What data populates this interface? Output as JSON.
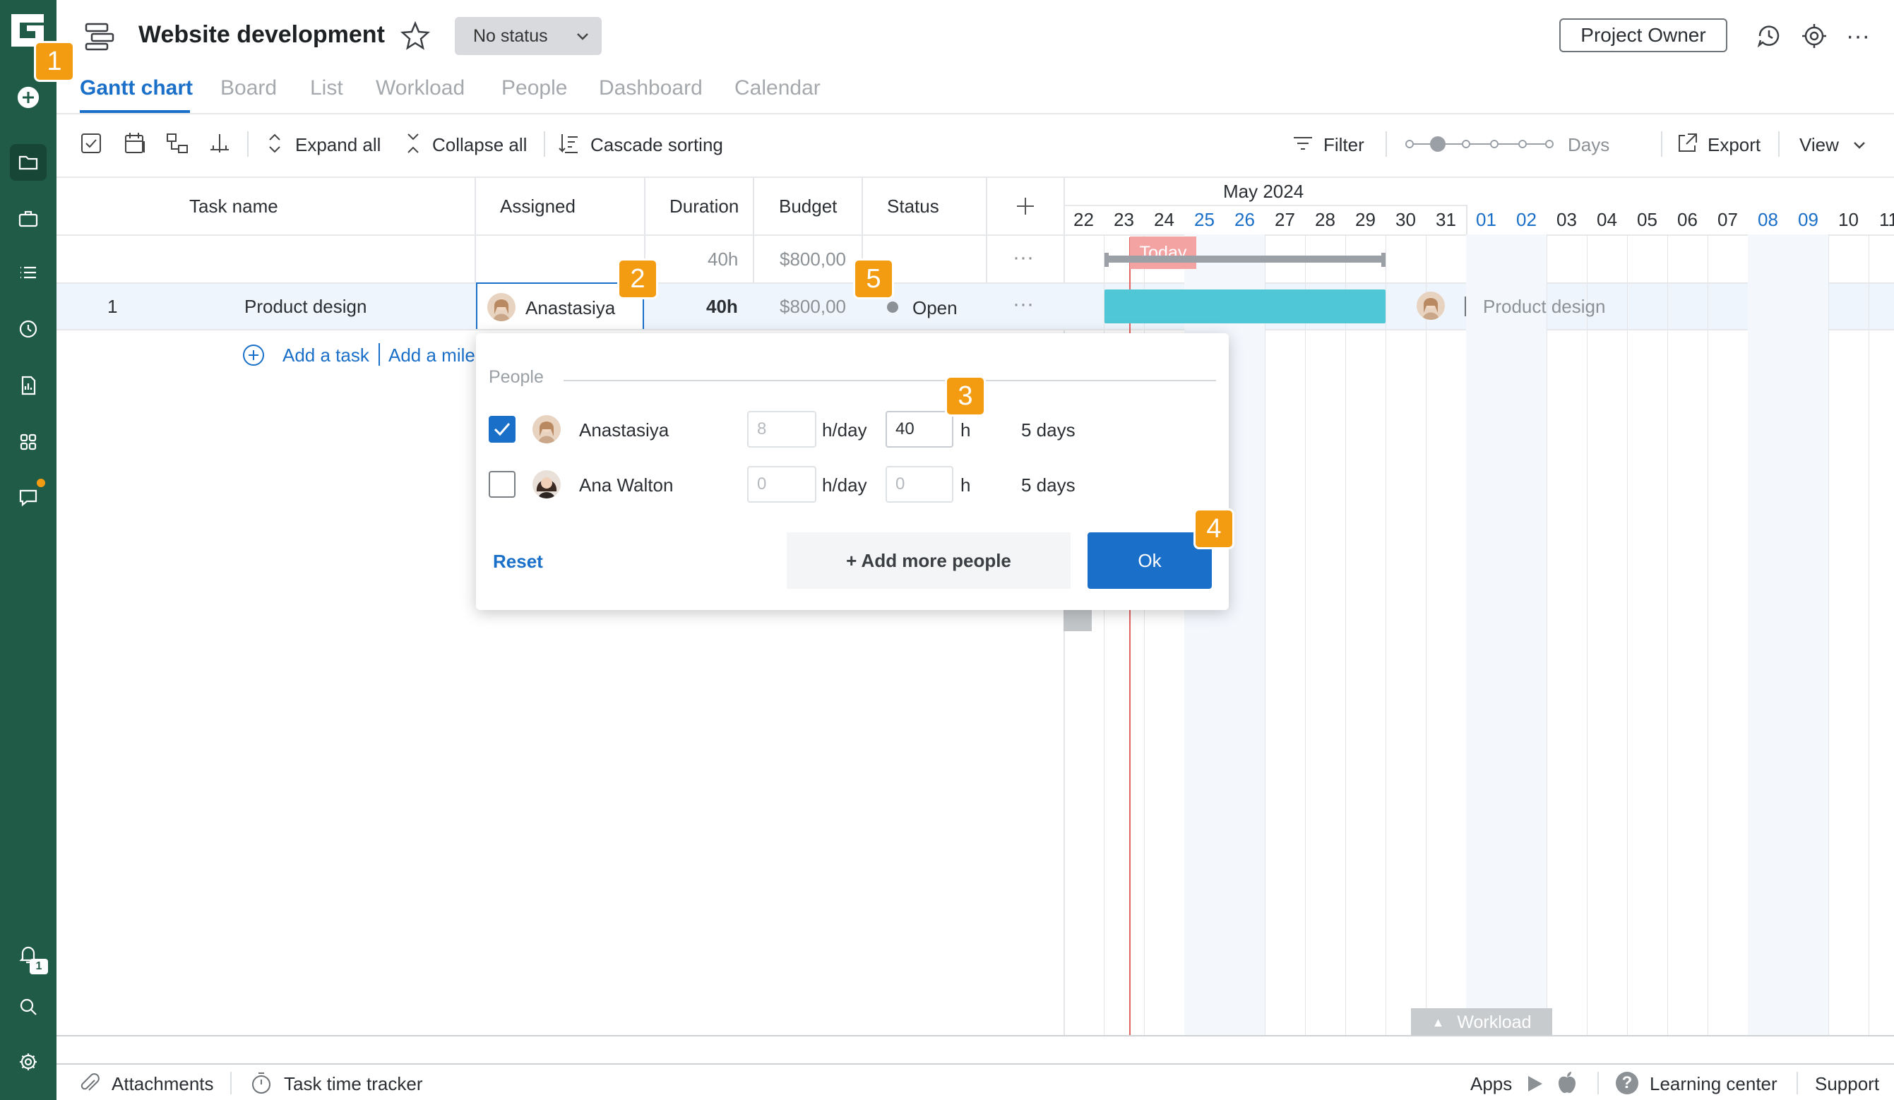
{
  "header": {
    "title": "Website development",
    "status": "No status",
    "owner_button": "Project Owner"
  },
  "tabs": [
    "Gantt chart",
    "Board",
    "List",
    "Workload",
    "People",
    "Dashboard",
    "Calendar"
  ],
  "toolbar": {
    "expand_all": "Expand all",
    "collapse_all": "Collapse all",
    "cascade_sorting": "Cascade sorting",
    "filter": "Filter",
    "zoom_label": "Days",
    "export": "Export",
    "view": "View"
  },
  "columns": {
    "task_name": "Task name",
    "assigned": "Assigned",
    "duration": "Duration",
    "budget": "Budget",
    "status": "Status"
  },
  "summary_row": {
    "duration": "40h",
    "budget": "$800,00"
  },
  "task_row": {
    "number": "1",
    "name": "Product design",
    "assignee": "Anastasiya",
    "duration": "40h",
    "budget": "$800,00",
    "status": "Open"
  },
  "add_task": "Add a task",
  "add_milestone": "Add a mile",
  "timeline": {
    "month": "May 2024",
    "today_label": "Today",
    "bar_label": "Product design",
    "days": [
      {
        "d": "22",
        "w": false
      },
      {
        "d": "23",
        "w": false
      },
      {
        "d": "24",
        "w": false
      },
      {
        "d": "25",
        "w": true
      },
      {
        "d": "26",
        "w": true
      },
      {
        "d": "27",
        "w": false
      },
      {
        "d": "28",
        "w": false
      },
      {
        "d": "29",
        "w": false
      },
      {
        "d": "30",
        "w": false
      },
      {
        "d": "31",
        "w": false
      },
      {
        "d": "01",
        "w": true
      },
      {
        "d": "02",
        "w": true
      },
      {
        "d": "03",
        "w": false
      },
      {
        "d": "04",
        "w": false
      },
      {
        "d": "05",
        "w": false
      },
      {
        "d": "06",
        "w": false
      },
      {
        "d": "07",
        "w": false
      },
      {
        "d": "08",
        "w": true
      },
      {
        "d": "09",
        "w": true
      },
      {
        "d": "10",
        "w": false
      },
      {
        "d": "11",
        "w": false
      }
    ],
    "workload_tab": "Workload"
  },
  "popup": {
    "section_label": "People",
    "people": [
      {
        "name": "Anastasiya",
        "checked": true,
        "per_day": "8",
        "per_day_unit": "h/day",
        "hours": "40",
        "hours_unit": "h",
        "days": "5 days"
      },
      {
        "name": "Ana Walton",
        "checked": false,
        "per_day": "0",
        "per_day_unit": "h/day",
        "hours": "0",
        "hours_unit": "h",
        "days": "5 days"
      }
    ],
    "reset": "Reset",
    "add_more": "+ Add more people",
    "ok": "Ok"
  },
  "badges": [
    "1",
    "2",
    "3",
    "4",
    "5"
  ],
  "notification_count": "1",
  "footer": {
    "attachments": "Attachments",
    "time_tracker": "Task time tracker",
    "apps": "Apps",
    "learning_center": "Learning center",
    "support": "Support"
  },
  "colors": {
    "rail": "#1f5b46",
    "accent": "#1a6fc9",
    "bar": "#4fc7d6",
    "today": "#f4a3a3",
    "badge": "#f39c12"
  }
}
